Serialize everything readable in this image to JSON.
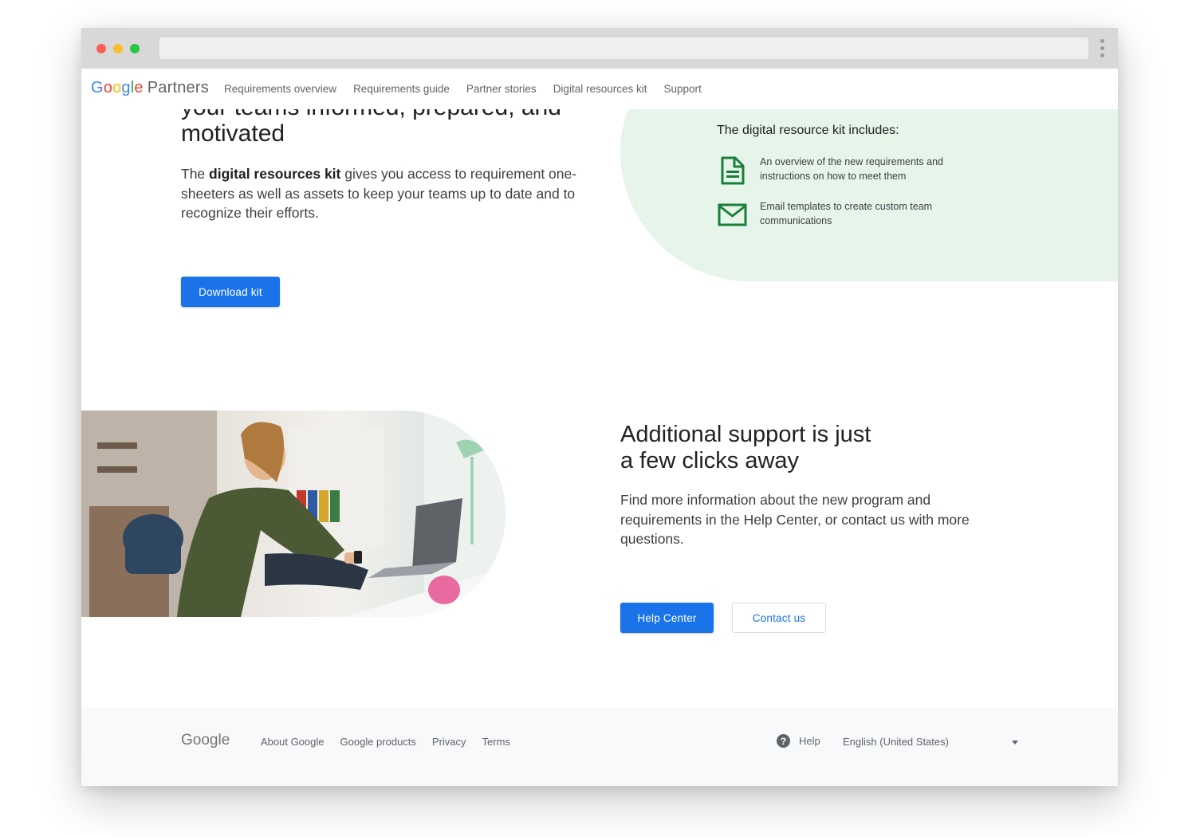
{
  "nav": {
    "logo_google": "Google",
    "logo_partners": "Partners",
    "links": [
      {
        "label": "Requirements overview"
      },
      {
        "label": "Requirements guide"
      },
      {
        "label": "Partner stories"
      },
      {
        "label": "Digital resources kit"
      },
      {
        "label": "Support"
      }
    ]
  },
  "hero": {
    "heading": "your teams informed, prepared, and motivated",
    "body_prefix": "The ",
    "body_bold": "digital resources kit",
    "body_suffix": " gives you access to requirement one-sheeters as well as assets to keep your teams up to date and to recognize their efforts.",
    "download_button": "Download kit"
  },
  "kit": {
    "title": "The digital resource kit includes:",
    "items": [
      {
        "icon": "document-icon",
        "text": "An overview of the new requirements and instructions on how to meet them"
      },
      {
        "icon": "mail-icon",
        "text": "Email templates to create custom team communications"
      }
    ]
  },
  "support": {
    "heading_line1": "Additional support is just",
    "heading_line2": "a few clicks away",
    "body": "Find more information about the new program and requirements in the Help Center, or contact us with more questions.",
    "help_center_button": "Help Center",
    "contact_button": "Contact us"
  },
  "footer": {
    "logo": "Google",
    "links": [
      {
        "label": "About Google"
      },
      {
        "label": "Google products"
      },
      {
        "label": "Privacy"
      },
      {
        "label": "Terms"
      }
    ],
    "help_label": "Help",
    "language": "English (United States)"
  },
  "colors": {
    "accent": "#1a73e8",
    "kit_panel": "#e6f4ea",
    "icon_green": "#188038",
    "footer_bg": "#f8f9fa"
  }
}
